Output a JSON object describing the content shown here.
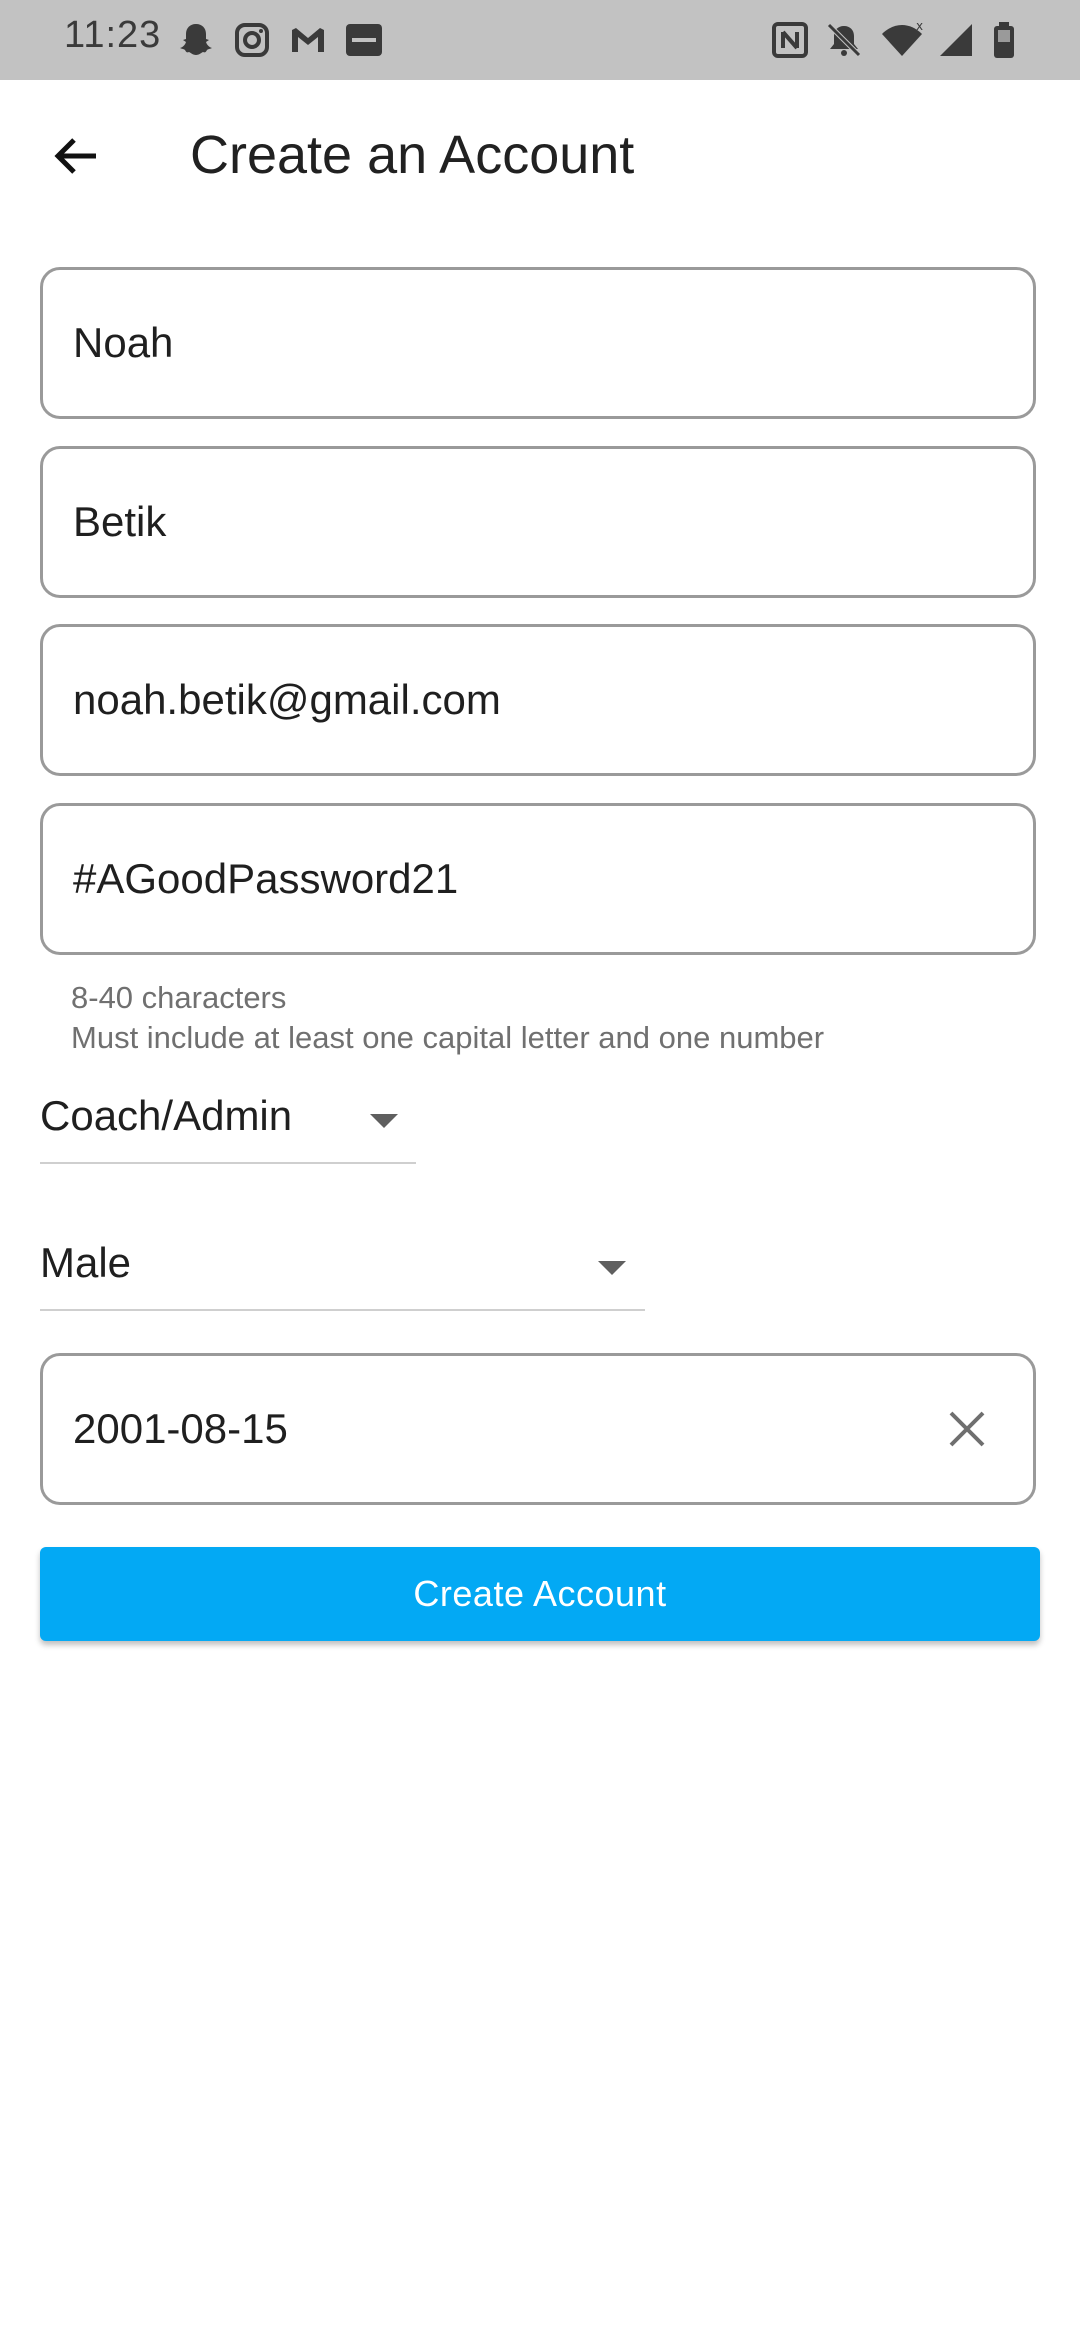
{
  "status_bar": {
    "time": "11:23",
    "left_icons": [
      "snapchat-icon",
      "instagram-icon",
      "gmail-icon",
      "tsn-icon"
    ],
    "right_icons": [
      "nfc-icon",
      "notifications-off-icon",
      "wifi-icon",
      "signal-icon",
      "battery-icon"
    ]
  },
  "app_bar": {
    "title": "Create an Account"
  },
  "form": {
    "first_name": "Noah",
    "last_name": "Betik",
    "email": "noah.betik@gmail.com",
    "password": "#AGoodPassword21",
    "password_helper_line1": "8-40 characters",
    "password_helper_line2": "Must include at least one capital letter and one number",
    "role": "Coach/Admin",
    "gender": "Male",
    "birthdate": "2001-08-15",
    "submit_label": "Create Account"
  },
  "colors": {
    "primary": "#03a9f4",
    "status_bar": "#c2c2c2",
    "field_border": "#9a9a9a"
  }
}
